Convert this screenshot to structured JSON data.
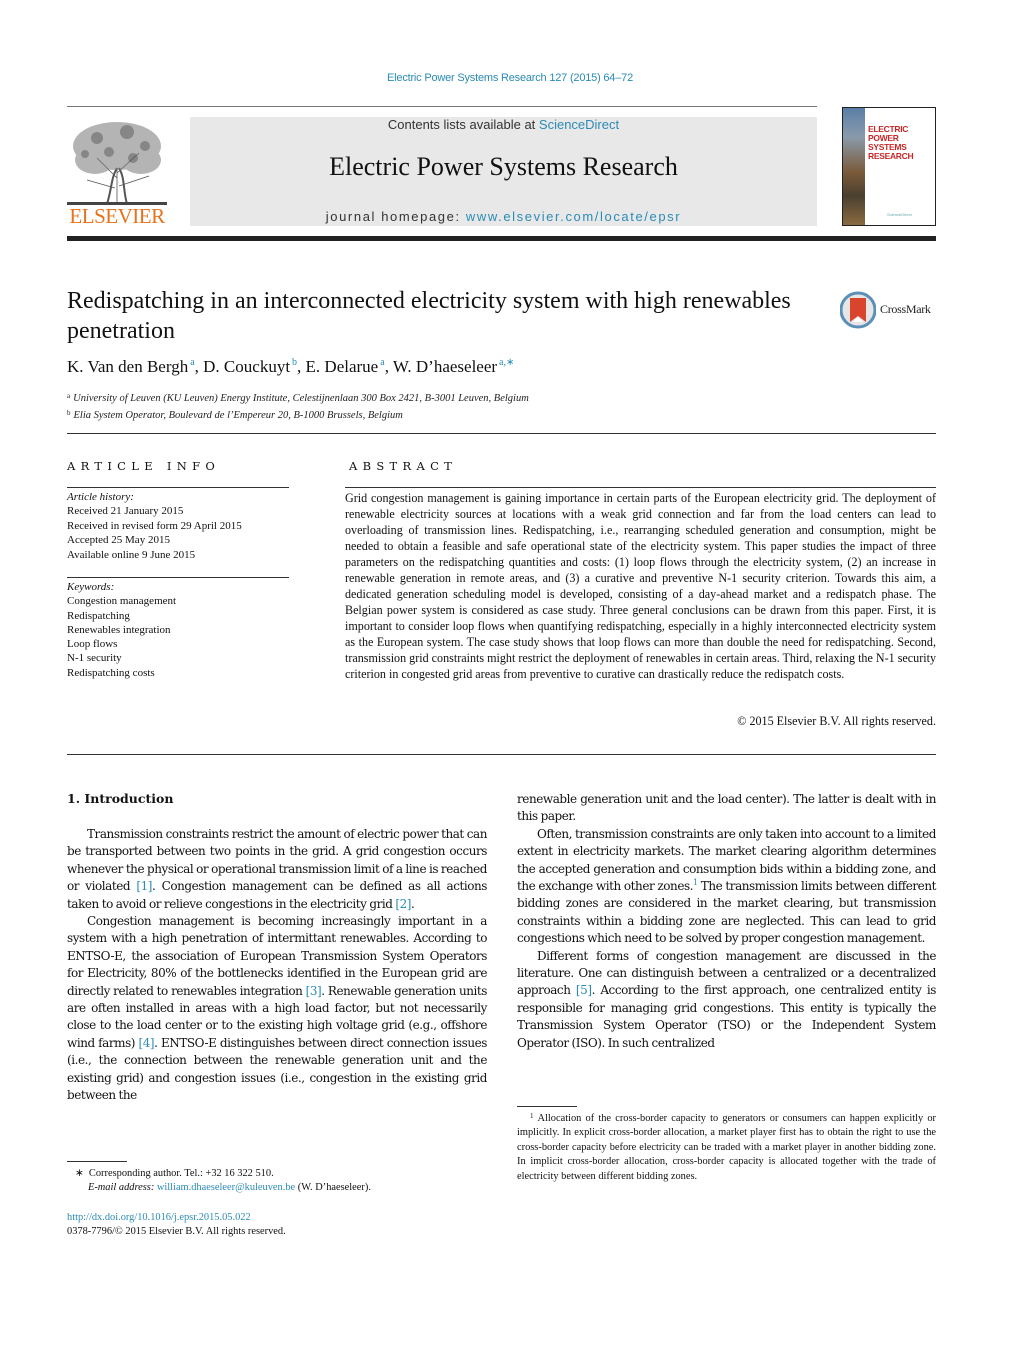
{
  "journal_header": {
    "citation": "Electric Power Systems Research 127 (2015) 64–72",
    "contents_prefix": "Contents lists available at ",
    "contents_link": "ScienceDirect",
    "journal_title": "Electric Power Systems Research",
    "homepage_prefix": "journal homepage: ",
    "homepage_link": "www.elsevier.com/locate/epsr",
    "publisher_logo_text": "ELSEVIER",
    "cover_title": "ELECTRIC POWER SYSTEMS RESEARCH",
    "cover_publisher": "ScienceDirect",
    "accent_color": "#2b8bb5",
    "publisher_color": "#e8721c"
  },
  "article": {
    "title": "Redispatching in an interconnected electricity system with high renewables penetration",
    "crossmark_label": "CrossMark",
    "authors": [
      {
        "name": "K. Van den Bergh",
        "sup": "a"
      },
      {
        "name": "D. Couckuyt",
        "sup": "b"
      },
      {
        "name": "E. Delarue",
        "sup": "a"
      },
      {
        "name": "W. D’haeseleer",
        "sup": "a,∗"
      }
    ],
    "separator": ", ",
    "affiliations": [
      {
        "sup": "a",
        "text": "University of Leuven (KU Leuven) Energy Institute, Celestijnenlaan 300 Box 2421, B-3001 Leuven, Belgium"
      },
      {
        "sup": "b",
        "text": "Elia System Operator, Boulevard de l’Empereur 20, B-1000 Brussels, Belgium"
      }
    ]
  },
  "article_info": {
    "heading": "ARTICLE INFO",
    "history_label": "Article history:",
    "history": [
      "Received 21 January 2015",
      "Received in revised form 29 April 2015",
      "Accepted 25 May 2015",
      "Available online 9 June 2015"
    ],
    "keywords_label": "Keywords:",
    "keywords": [
      "Congestion management",
      "Redispatching",
      "Renewables integration",
      "Loop flows",
      "N-1 security",
      "Redispatching costs"
    ]
  },
  "abstract": {
    "heading": "ABSTRACT",
    "text": "Grid congestion management is gaining importance in certain parts of the European electricity grid. The deployment of renewable electricity sources at locations with a weak grid connection and far from the load centers can lead to overloading of transmission lines. Redispatching, i.e., rearranging scheduled generation and consumption, might be needed to obtain a feasible and safe operational state of the electricity system. This paper studies the impact of three parameters on the redispatching quantities and costs: (1) loop flows through the electricity system, (2) an increase in renewable generation in remote areas, and (3) a curative and preventive N-1 security criterion. Towards this aim, a dedicated generation scheduling model is developed, consisting of a day-ahead market and a redispatch phase. The Belgian power system is considered as case study. Three general conclusions can be drawn from this paper. First, it is important to consider loop flows when quantifying redispatching, especially in a highly interconnected electricity system as the European system. The case study shows that loop flows can more than double the need for redispatching. Second, transmission grid constraints might restrict the deployment of renewables in certain areas. Third, relaxing the N-1 security criterion in congested grid areas from preventive to curative can drastically reduce the redispatch costs.",
    "copyright": "© 2015 Elsevier B.V. All rights reserved."
  },
  "body": {
    "section_heading": "1.  Introduction",
    "left": {
      "p1": {
        "a": "Transmission constraints restrict the amount of electric power that can be transported between two points in the grid. A grid congestion occurs whenever the physical or operational transmission limit of a line is reached or violated ",
        "ref1": "[1]",
        "b": ". Congestion management can be defined as all actions taken to avoid or relieve congestions in the electricity grid ",
        "ref2": "[2]",
        "c": "."
      },
      "p2": {
        "a": "Congestion management is becoming increasingly important in a system with a high penetration of intermittant renewables. According to ENTSO-E, the association of European Transmission System Operators for Electricity, 80% of the bottlenecks identified in the European grid are directly related to renewables integration ",
        "ref3": "[3]",
        "b": ". Renewable generation units are often installed in areas with a high load factor, but not necessarily close to the load center or to the existing high voltage grid (e.g., offshore wind farms) ",
        "ref4": "[4]",
        "c": ". ENTSO-E distinguishes between direct connection issues (i.e., the connection between the renewable generation unit and the existing grid) and congestion issues (i.e., congestion in the existing grid between the"
      }
    },
    "right": {
      "p0": "renewable generation unit and the load center). The latter is dealt with in this paper.",
      "p1": {
        "a": "Often, transmission constraints are only taken into account to a limited extent in electricity markets. The market clearing algorithm determines the accepted generation and consumption bids within a bidding zone, and the exchange with other zones.",
        "fnref": "1",
        "b": " The transmission limits between different bidding zones are considered in the market clearing, but transmission constraints within a bidding zone are neglected. This can lead to grid congestions which need to be solved by proper congestion management."
      },
      "p2": {
        "a": "Different forms of congestion management are discussed in the literature. One can distinguish between a centralized or a decentralized approach ",
        "ref5": "[5]",
        "b": ". According to the first approach, one centralized entity is responsible for managing grid congestions. This entity is typically the Transmission System Operator (TSO) or the Independent System Operator (ISO). In such centralized"
      }
    }
  },
  "footnotes": {
    "author_mark": "∗",
    "author_text": "Corresponding author. Tel.: +32 16 322 510.",
    "email_label": "E-mail address: ",
    "email": "william.dhaeseleer@kuleuven.be",
    "email_suffix": " (W. D’haeseleer).",
    "fn1_mark": "1",
    "fn1_text": "Allocation of the cross-border capacity to generators or consumers can happen explicitly or implicitly. In explicit cross-border allocation, a market player first has to obtain the right to use the cross-border capacity before electricity can be traded with a market player in another bidding zone. In implicit cross-border allocation, cross-border capacity is allocated together with the trade of electricity between different bidding zones.",
    "doi": "http://dx.doi.org/10.1016/j.epsr.2015.05.022",
    "issn_copyright": "0378-7796/© 2015 Elsevier B.V. All rights reserved."
  }
}
